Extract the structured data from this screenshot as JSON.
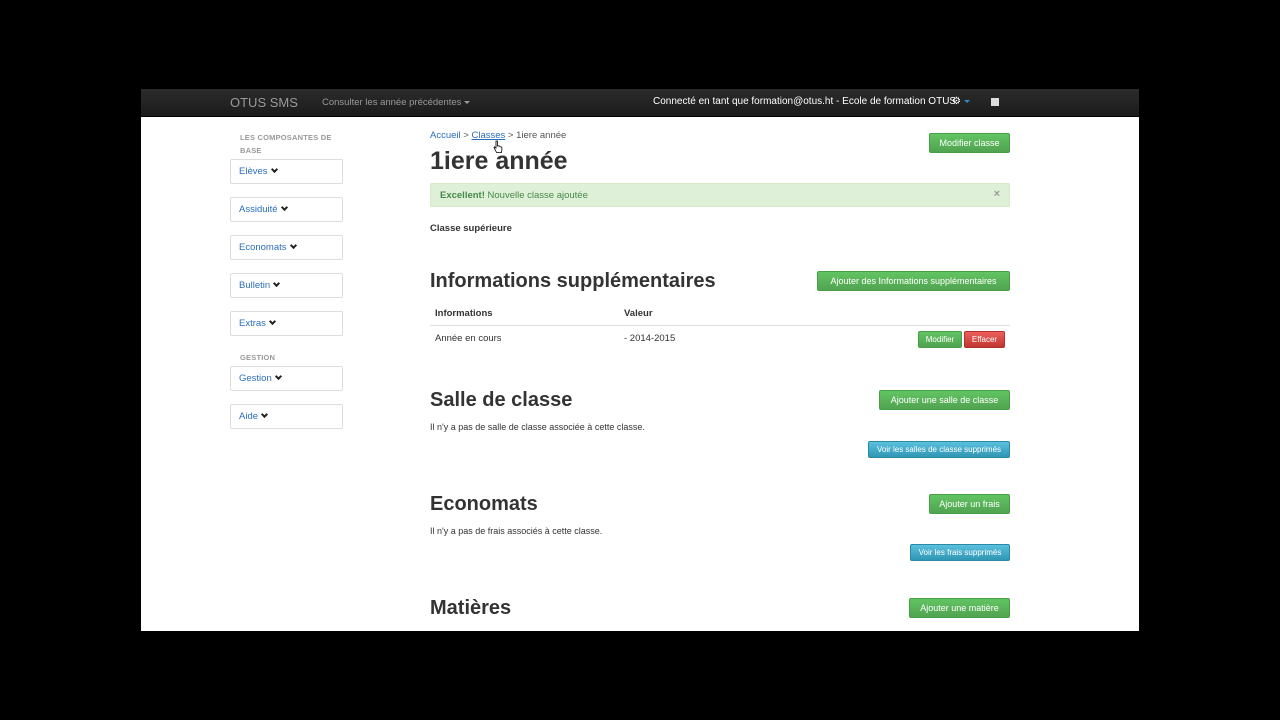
{
  "navbar": {
    "brand": "OTUS SMS",
    "prev_years": "Consulter les année précédentes",
    "user": "Connecté en tant que formation@otus.ht - Ecole de formation OTUS",
    "gear": "⚙"
  },
  "sidebar": {
    "header_base": "LES COMPOSANTES DE BASE",
    "items": [
      "Elèves",
      "Assiduité",
      "Economats",
      "Bulletin",
      "Extras"
    ],
    "header_gestion": "GESTION",
    "gestion_items": [
      "Gestion",
      "Aide"
    ]
  },
  "breadcrumb": {
    "home": "Accueil",
    "sep1": ">",
    "classes": "Classes",
    "sep2": ">",
    "current": "1iere année"
  },
  "page": {
    "title": "1iere année",
    "edit_button": "Modifier classe",
    "alert_strong": "Excellent!",
    "alert_text": "Nouvelle classe ajoutée",
    "alert_close": "×",
    "classe_sup": "Classe supérieure"
  },
  "info": {
    "title": "Informations supplémentaires",
    "add_button": "Ajouter des Informations supplémentaires",
    "col_info": "Informations",
    "col_value": "Valeur",
    "rows": [
      {
        "info": "Année en cours",
        "value": "- 2014-2015",
        "edit": "Modifier",
        "delete": "Effacer"
      }
    ]
  },
  "salle": {
    "title": "Salle de classe",
    "add_button": "Ajouter une salle de classe",
    "empty": "Il n'y a pas de salle de classe associée à cette classe.",
    "deleted_button": "Voir les salles de classe supprimés"
  },
  "economats": {
    "title": "Economats",
    "add_button": "Ajouter un frais",
    "empty": "Il n'y a pas de frais associés à cette classe.",
    "deleted_button": "Voir les frais supprimés"
  },
  "matieres": {
    "title": "Matières",
    "add_button": "Ajouter une matière"
  }
}
